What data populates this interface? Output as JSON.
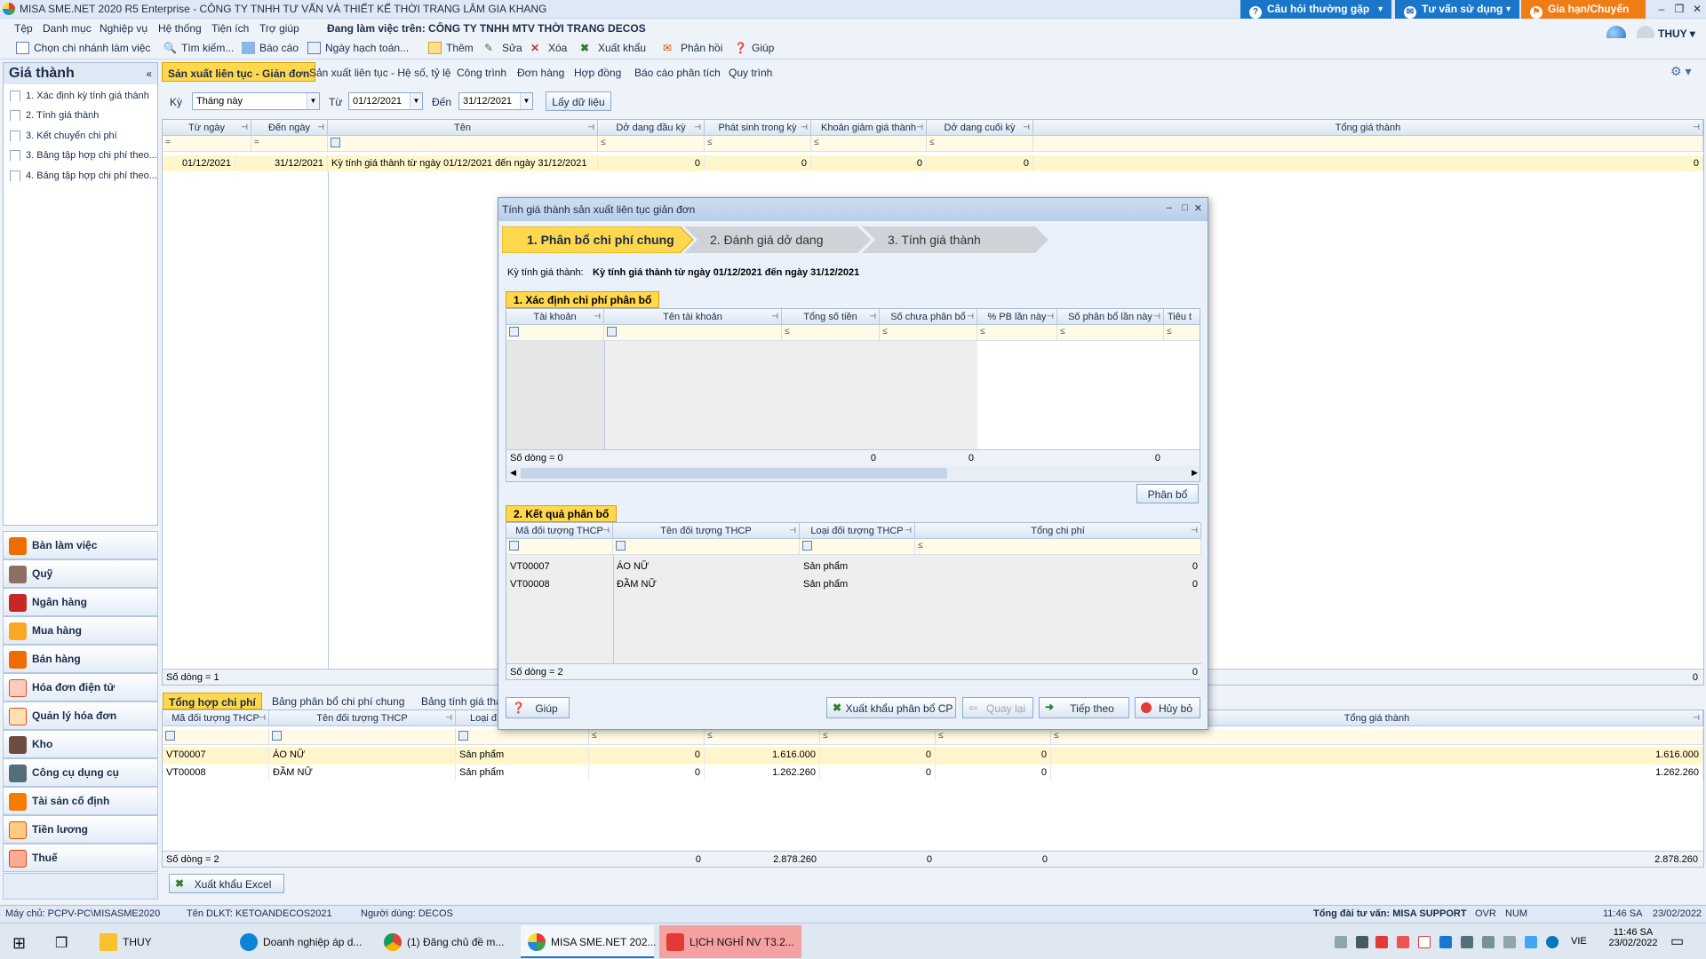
{
  "window": {
    "title": "MISA SME.NET 2020 R5 Enterprise - CÔNG TY TNHH TƯ VẤN VÀ THIẾT KẾ THỜI TRANG LÂM GIA KHANG"
  },
  "top_buttons": {
    "faq": "Câu hỏi thường gặp",
    "guide": "Tư vấn sử dụng",
    "renew": "Gia hạn/Chuyển gói"
  },
  "menu": {
    "items": [
      "Tệp",
      "Danh mục",
      "Nghiệp vụ",
      "Hệ thống",
      "Tiện ích",
      "Trợ giúp"
    ],
    "workplace_label": "Đang làm việc trên:",
    "workplace_value": "CÔNG TY TNHH MTV THỜI TRANG DECOS"
  },
  "toolbar": {
    "branch": "Chọn chi nhánh làm việc",
    "search": "Tìm kiếm...",
    "report": "Báo cáo",
    "posting_date": "Ngày hạch toán...",
    "add": "Thêm",
    "edit": "Sửa",
    "delete": "Xóa",
    "export": "Xuất khẩu",
    "feedback": "Phản hồi",
    "help": "Giúp"
  },
  "user": {
    "name": "THUY"
  },
  "left_panel": {
    "title": "Giá thành",
    "items": [
      "1. Xác định kỳ tính giá thành",
      "2. Tính giá thành",
      "3. Kết chuyển chi phí",
      "3. Bảng tập hợp chi phí theo...",
      "4. Bảng tập hợp chi phí theo..."
    ]
  },
  "modules": [
    "Bàn làm việc",
    "Quỹ",
    "Ngân hàng",
    "Mua hàng",
    "Bán hàng",
    "Hóa đơn điện tử",
    "Quản lý hóa đơn",
    "Kho",
    "Công cụ dụng cụ",
    "Tài sản cố định",
    "Tiền lương",
    "Thuế"
  ],
  "main_tabs": [
    "Sản xuất liên tục - Giản đơn",
    "Sản xuất liên tục - Hệ số, tỷ lệ",
    "Công trình",
    "Đơn hàng",
    "Hợp đồng",
    "Báo cáo phân tích",
    "Quy trình"
  ],
  "filter": {
    "period_label": "Kỳ",
    "period_value": "Tháng này",
    "from_label": "Từ",
    "from_value": "01/12/2021",
    "to_label": "Đến",
    "to_value": "31/12/2021",
    "fetch_button": "Lấy dữ liệu"
  },
  "period_grid": {
    "columns": [
      "Từ ngày",
      "Đến ngày",
      "Tên",
      "Dở dang đầu kỳ",
      "Phát sinh trong kỳ",
      "Khoản giảm giá thành",
      "Dở dang cuối kỳ",
      "Tổng giá thành"
    ],
    "rows": [
      [
        "01/12/2021",
        "31/12/2021",
        "Kỳ tính giá thành từ ngày 01/12/2021 đến ngày 31/12/2021",
        "0",
        "0",
        "0",
        "0",
        "0"
      ]
    ],
    "footer_label": "Số dòng = 1",
    "footer_total": "0"
  },
  "bottom_tabs": [
    "Tổng hợp chi phí",
    "Bảng phân bổ chi phí chung",
    "Bảng tính giá thành"
  ],
  "bottom_grid": {
    "columns": [
      "Mã đối tượng THCP",
      "Tên đối tượng THCP",
      "Loại đ",
      "Tổng giá thành"
    ],
    "rows": [
      [
        "VT00007",
        "ÁO NỮ",
        "Sản phẩm",
        "0",
        "1.616.000",
        "0",
        "0",
        "1.616.000"
      ],
      [
        "VT00008",
        "ĐẦM NỮ",
        "Sản phẩm",
        "0",
        "1.262.260",
        "0",
        "0",
        "1.262.260"
      ]
    ],
    "footer_label": "Số dòng = 2",
    "footer_values": [
      "0",
      "2.878.260",
      "0",
      "0",
      "2.878.260"
    ],
    "export_button": "Xuất khẩu Excel"
  },
  "dialog": {
    "title": "Tính giá thành sản xuất liên tục giản đơn",
    "steps": [
      "1. Phân bổ chi phí chung",
      "2. Đánh giá dở dang",
      "3. Tính giá thành"
    ],
    "period_label": "Kỳ tính giá thành:",
    "period_value": "Kỳ tính giá thành từ ngày 01/12/2021 đến ngày 31/12/2021",
    "section1": {
      "title": "1. Xác định chi phí phân bổ",
      "columns": [
        "Tài khoản",
        "Tên tài khoản",
        "Tổng số tiền",
        "Số chưa phân bổ",
        "% PB lần này",
        "Số phân bổ lần này",
        "Tiêu t"
      ],
      "footer_label": "Số dòng = 0",
      "footer_values": [
        "0",
        "0",
        "0"
      ]
    },
    "allocate_button": "Phân bổ",
    "section2": {
      "title": "2. Kết quả phân bổ",
      "columns": [
        "Mã đối tượng THCP",
        "Tên đối tượng THCP",
        "Loại đối tượng THCP",
        "Tổng chi phí"
      ],
      "rows": [
        [
          "VT00007",
          "ÁO NỮ",
          "Sản phẩm",
          "0"
        ],
        [
          "VT00008",
          "ĐẦM NỮ",
          "Sản phẩm",
          "0"
        ]
      ],
      "footer_label": "Số dòng = 2",
      "footer_total": "0"
    },
    "buttons": {
      "help": "Giúp",
      "export": "Xuất khẩu phân bổ CP",
      "back": "Quay lại",
      "next": "Tiếp theo",
      "cancel": "Hủy bỏ"
    }
  },
  "status": {
    "server": "Máy chủ: PCPV-PC\\MISASME2020",
    "db": "Tên DLKT: KETOANDECOS2021",
    "user": "Người dùng: DECOS",
    "support": "Tổng đài tư vấn: MISA SUPPORT",
    "ovr": "OVR",
    "num": "NUM",
    "time": "11:46 SA",
    "date": "23/02/2022"
  },
  "taskbar": {
    "items": [
      "THUY",
      "Doanh nghiệp áp d...",
      "(1) Đăng chủ đề m...",
      "MISA SME.NET 202...",
      "LỊCH NGHỈ NV T3.2..."
    ],
    "lang": "VIE",
    "time": "11:46 SA",
    "date": "23/02/2022"
  }
}
